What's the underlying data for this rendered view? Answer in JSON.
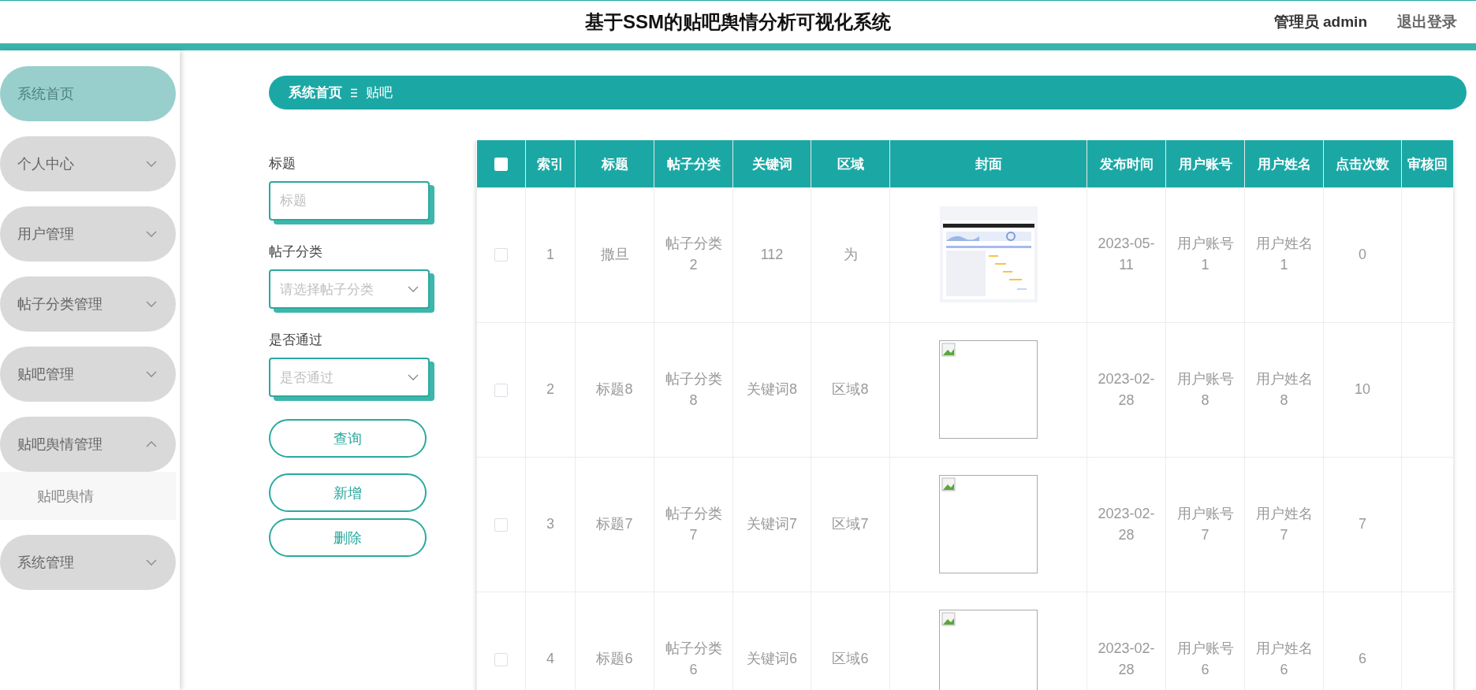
{
  "header": {
    "title": "基于SSM的贴吧舆情分析可视化系统",
    "user": "管理员 admin",
    "logout": "退出登录"
  },
  "sidebar": {
    "items": [
      {
        "label": "系统首页",
        "selected": true
      },
      {
        "label": "个人中心",
        "selected": false,
        "expanded": false
      },
      {
        "label": "用户管理",
        "selected": false,
        "expanded": false
      },
      {
        "label": "帖子分类管理",
        "selected": false,
        "expanded": false
      },
      {
        "label": "贴吧管理",
        "selected": false,
        "expanded": false
      },
      {
        "label": "贴吧舆情管理",
        "selected": false,
        "expanded": true,
        "children": [
          {
            "label": "贴吧舆情",
            "selected": false
          }
        ]
      },
      {
        "label": "系统管理",
        "selected": false,
        "expanded": false
      }
    ]
  },
  "breadcrumb": {
    "home": "系统首页",
    "current": "贴吧"
  },
  "filters": [
    {
      "kind": "input",
      "label": "标题",
      "placeholder": "标题"
    },
    {
      "kind": "select",
      "label": "帖子分类",
      "placeholder": "请选择帖子分类"
    },
    {
      "kind": "select",
      "label": "是否通过",
      "placeholder": "是否通过"
    }
  ],
  "buttons": [
    "查询",
    "新增",
    "删除"
  ],
  "table": {
    "columns": [
      "索引",
      "标题",
      "帖子分类",
      "关键词",
      "区域",
      "封面",
      "发布时间",
      "用户账号",
      "用户姓名",
      "点击次数",
      "审核回"
    ],
    "all_checked": false,
    "rows": [
      {
        "checked": false,
        "index": "1",
        "title": "撒旦",
        "category": "帖子分类2",
        "keyword": "112",
        "region": "为",
        "time": "2023-05-11",
        "account": "用户账号1",
        "name": "用户姓名1",
        "clicks": "0"
      },
      {
        "checked": false,
        "index": "2",
        "title": "标题8",
        "category": "帖子分类8",
        "keyword": "关键词8",
        "region": "区域8",
        "cover": {
          "kind": "broken"
        },
        "time": "2023-02-28",
        "account": "用户账号8",
        "name": "用户姓名8",
        "clicks": "10"
      },
      {
        "checked": false,
        "index": "3",
        "title": "标题7",
        "category": "帖子分类7",
        "keyword": "关键词7",
        "region": "区域7",
        "cover": {
          "kind": "broken"
        },
        "time": "2023-02-28",
        "account": "用户账号7",
        "name": "用户姓名7",
        "clicks": "7"
      },
      {
        "checked": false,
        "index": "4",
        "title": "标题6",
        "category": "帖子分类6",
        "keyword": "关键词6",
        "region": "区域6",
        "cover": {
          "kind": "broken"
        },
        "time": "2023-02-28",
        "account": "用户账号6",
        "name": "用户姓名6",
        "clicks": "6"
      }
    ]
  }
}
